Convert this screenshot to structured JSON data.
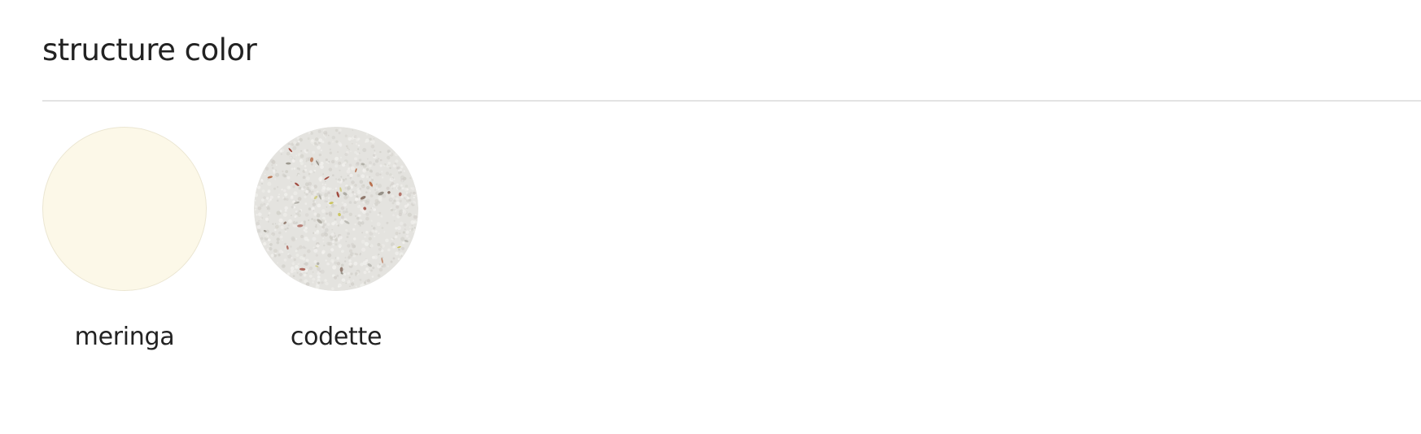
{
  "section": {
    "title": "structure color"
  },
  "swatches": [
    {
      "label": "meringa",
      "color": "#fcf8e8",
      "border_color": "#ebe6d2"
    },
    {
      "label": "codette",
      "color": "#e4e3df",
      "speckle_colors": [
        "#9a3b2e",
        "#6b4a3a",
        "#b5653f",
        "#c9c35a",
        "#8f8a80",
        "#a8a69e"
      ]
    }
  ]
}
